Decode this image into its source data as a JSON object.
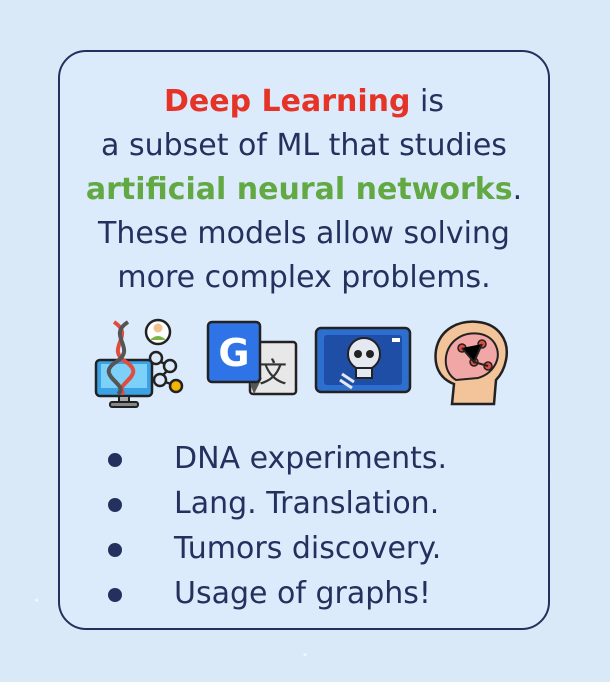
{
  "intro": {
    "line1_highlight": "Deep Learning",
    "line1_rest": " is",
    "line2": "a subset of ML that studies",
    "line3_highlight": "artificial neural networks",
    "line3_rest": ".",
    "line4": "These models allow solving",
    "line5": "more complex problems."
  },
  "icons": [
    "dna-computer-icon",
    "google-translate-icon",
    "xray-skull-icon",
    "brain-network-head-icon"
  ],
  "bullets": [
    "DNA experiments.",
    "Lang. Translation.",
    "Tumors discovery.",
    "Usage of graphs!"
  ],
  "colors": {
    "accent_red": "#e53427",
    "accent_green": "#62a843",
    "text_navy": "#24305e",
    "card_bg": "#dcebfb"
  }
}
